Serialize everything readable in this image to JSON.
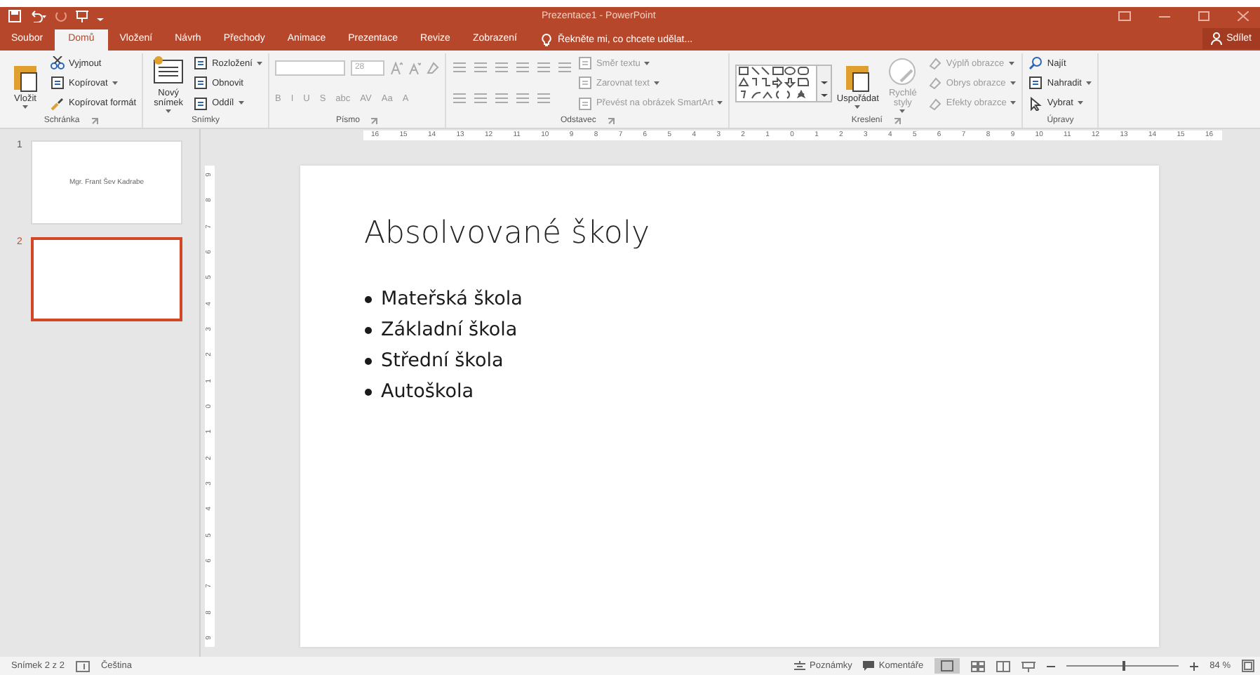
{
  "window": {
    "title": "Prezentace1 - PowerPoint"
  },
  "tabs": [
    {
      "label": "Soubor",
      "selected": false
    },
    {
      "label": "Domů",
      "selected": true
    },
    {
      "label": "Vložení",
      "selected": false
    },
    {
      "label": "Návrh",
      "selected": false
    },
    {
      "label": "Přechody",
      "selected": false
    },
    {
      "label": "Animace",
      "selected": false
    },
    {
      "label": "Prezentace",
      "selected": false
    },
    {
      "label": "Revize",
      "selected": false
    },
    {
      "label": "Zobrazení",
      "selected": false
    }
  ],
  "tell_me": "Řekněte mi, co chcete udělat...",
  "share": "Sdílet",
  "ribbon": {
    "groups": [
      {
        "label": "Schránka",
        "launcher": true,
        "columns": [
          [
            {
              "kind": "big",
              "label": "Vložit",
              "dropdown": true,
              "disabled": false
            }
          ],
          [
            {
              "kind": "small",
              "label": "Vyjmout",
              "dropdown": false,
              "disabled": false
            },
            {
              "kind": "small",
              "label": "Kopírovat",
              "dropdown": true,
              "disabled": false
            },
            {
              "kind": "small",
              "label": "Kopírovat formát",
              "dropdown": false,
              "disabled": false
            }
          ]
        ]
      },
      {
        "label": "Snímky",
        "launcher": false,
        "columns": [
          [
            {
              "kind": "big",
              "label": "Nový snímek",
              "dropdown": true,
              "disabled": false
            }
          ],
          [
            {
              "kind": "small",
              "label": "Rozložení",
              "dropdown": true,
              "disabled": false
            },
            {
              "kind": "small",
              "label": "Obnovit",
              "dropdown": false,
              "disabled": false
            },
            {
              "kind": "small",
              "label": "Oddíl",
              "dropdown": true,
              "disabled": false
            }
          ]
        ]
      },
      {
        "label": "Písmo",
        "launcher": true,
        "columns": [
          [
            {
              "kind": "fontrow",
              "size": "28",
              "disabled": true
            },
            {
              "kind": "glyphs",
              "glyphs": [
                "B",
                "I",
                "U",
                "S",
                "abc",
                "AV",
                "Aa",
                "A"
              ],
              "disabled": true
            }
          ]
        ]
      },
      {
        "label": "Odstavec",
        "launcher": true,
        "columns": [
          [
            {
              "kind": "iconrow",
              "disabled": true
            },
            {
              "kind": "iconrow",
              "disabled": true
            }
          ],
          [
            {
              "kind": "small",
              "label": "Směr textu",
              "dropdown": true,
              "disabled": true
            },
            {
              "kind": "small",
              "label": "Zarovnat text",
              "dropdown": true,
              "disabled": true
            },
            {
              "kind": "small",
              "label": "Převést na obrázek SmartArt",
              "dropdown": true,
              "disabled": true
            }
          ]
        ]
      },
      {
        "label": "Kreslení",
        "launcher": true,
        "columns": [
          [
            {
              "kind": "gallery",
              "disabled": false
            }
          ],
          [
            {
              "kind": "big",
              "label": "Uspořádat",
              "dropdown": true,
              "disabled": false
            }
          ],
          [
            {
              "kind": "big",
              "label": "Rychlé styly",
              "dropdown": true,
              "disabled": true
            }
          ],
          [
            {
              "kind": "small",
              "label": "Výplň obrazce",
              "dropdown": true,
              "disabled": true
            },
            {
              "kind": "small",
              "label": "Obrys obrazce",
              "dropdown": true,
              "disabled": true
            },
            {
              "kind": "small",
              "label": "Efekty obrazce",
              "dropdown": true,
              "disabled": true
            }
          ]
        ]
      },
      {
        "label": "Úpravy",
        "launcher": false,
        "columns": [
          [
            {
              "kind": "small",
              "label": "Najít",
              "dropdown": false,
              "disabled": false
            },
            {
              "kind": "small",
              "label": "Nahradit",
              "dropdown": true,
              "disabled": false
            },
            {
              "kind": "small",
              "label": "Vybrat",
              "dropdown": true,
              "disabled": false
            }
          ]
        ]
      }
    ]
  },
  "ruler": {
    "horizontal": [
      "16",
      "15",
      "14",
      "13",
      "12",
      "11",
      "10",
      "9",
      "8",
      "7",
      "6",
      "5",
      "4",
      "3",
      "2",
      "1",
      "0",
      "1",
      "2",
      "3",
      "4",
      "5",
      "6",
      "7",
      "8",
      "9",
      "10",
      "11",
      "12",
      "13",
      "14",
      "15",
      "16"
    ],
    "vertical": [
      "9",
      "8",
      "7",
      "6",
      "5",
      "4",
      "3",
      "2",
      "1",
      "0",
      "1",
      "2",
      "3",
      "4",
      "5",
      "6",
      "7",
      "8",
      "9"
    ]
  },
  "slides": [
    {
      "number": "1",
      "selected": false,
      "text": "Mgr. Frant Šev Kadrabe"
    },
    {
      "number": "2",
      "selected": true
    }
  ],
  "slide": {
    "title": "Absolvované školy",
    "bullets": [
      "Mateřská škola",
      "Základní škola",
      "Střední škola",
      "Autoškola"
    ]
  },
  "status_bar": {
    "slide": "Snímek 2 z 2",
    "language": "Čeština",
    "notes": "Poznámky",
    "comments": "Komentáře",
    "zoom": "84 %",
    "level": 0.5
  }
}
